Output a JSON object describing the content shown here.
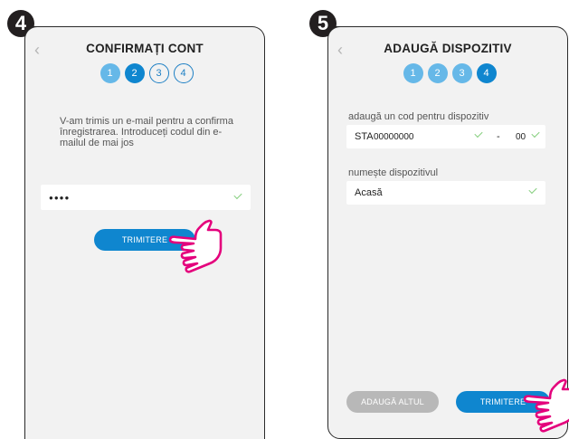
{
  "screens": [
    {
      "step_badge": "4",
      "title": "CONFIRMAȚI CONT",
      "steps": [
        "1",
        "2",
        "3",
        "4"
      ],
      "message": "V-am trimis un e-mail pentru a confirma înregistrarea. Introduceți codul din e-mailul de mai jos",
      "code_value": "●●●●",
      "submit_label": "TRIMITERE"
    },
    {
      "step_badge": "5",
      "title": "ADAUGĂ DISPOZITIV",
      "steps": [
        "1",
        "2",
        "3",
        "4"
      ],
      "code_label": "adaugă un cod pentru dispozitiv",
      "code_prefix": "STA",
      "code_main": "00000000",
      "code_separator": "-",
      "code_suffix": "00",
      "name_label": "numește dispozitivul",
      "name_value": "Acasă",
      "add_another_label": "ADAUGĂ ALTUL",
      "submit_label": "TRIMITERE"
    }
  ],
  "icons": {
    "back": "chevron-left-icon",
    "valid": "check-icon",
    "pointer": "pointing-hand-icon"
  },
  "colors": {
    "accent": "#0f86cf",
    "step_done": "#66b8e8",
    "disabled": "#b8b8b8",
    "check": "#86cf7f",
    "hand": "#e4007c"
  }
}
